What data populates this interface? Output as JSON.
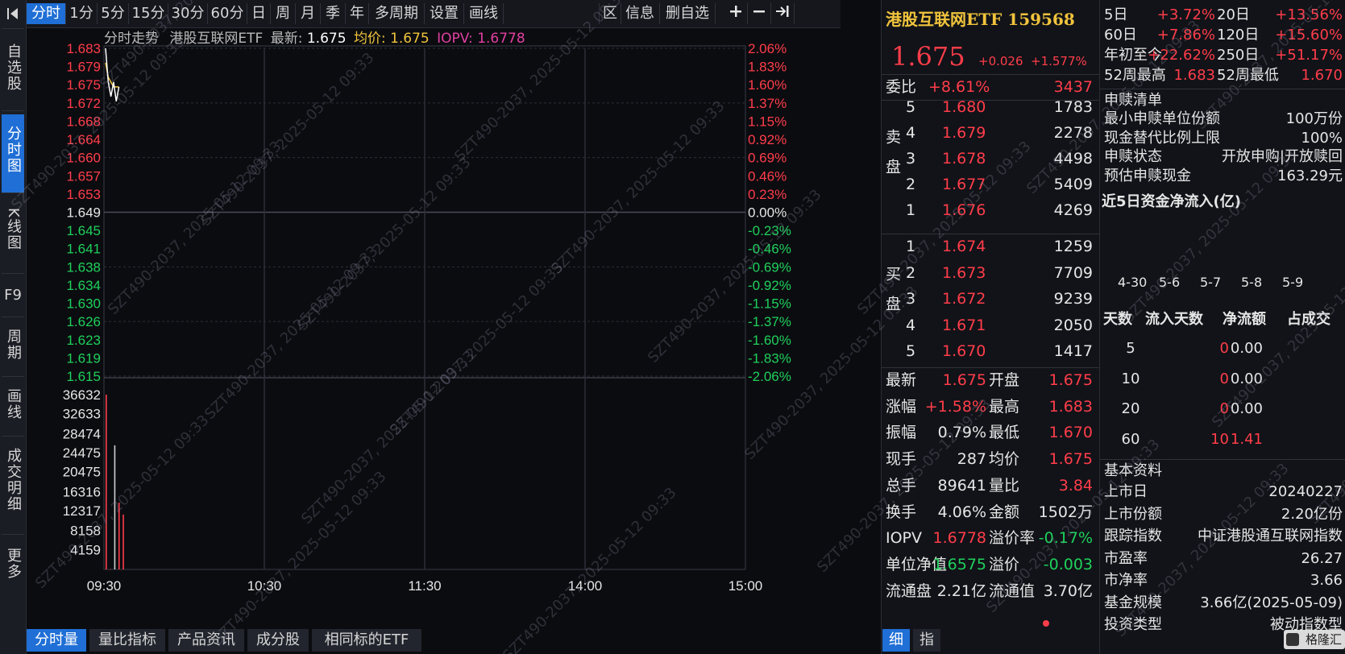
{
  "sidebar": {
    "items": [
      {
        "label": "自选股"
      },
      {
        "label": "分时图"
      },
      {
        "label": "K线图"
      },
      {
        "label": "F9"
      },
      {
        "label": "周期"
      },
      {
        "label": "画线"
      },
      {
        "label": "成交明细"
      },
      {
        "label": "更多"
      }
    ],
    "active_index": 1
  },
  "toolbar": {
    "items": [
      "分时",
      "1分",
      "5分",
      "15分",
      "30分",
      "60分",
      "日",
      "周",
      "月",
      "季",
      "年",
      "多周期",
      "设置",
      "画线"
    ],
    "right_items": [
      "区",
      "信息",
      "删自选"
    ]
  },
  "chart_header": {
    "title": "分时走势",
    "name": "港股互联网ETF",
    "latest_label": "最新:",
    "latest_value": "1.675",
    "avg_label": "均价:",
    "avg_value": "1.675",
    "iopv_label": "IOPV:",
    "iopv_value": "1.6778"
  },
  "chart_data": {
    "type": "line",
    "price_ticks": [
      "1.683",
      "1.679",
      "1.675",
      "1.672",
      "1.668",
      "1.664",
      "1.660",
      "1.657",
      "1.653",
      "1.649",
      "1.645",
      "1.641",
      "1.638",
      "1.634",
      "1.630",
      "1.626",
      "1.623",
      "1.619",
      "1.615"
    ],
    "pct_ticks": [
      "2.06%",
      "1.83%",
      "1.60%",
      "1.37%",
      "1.15%",
      "0.92%",
      "0.69%",
      "0.46%",
      "0.23%",
      "0.00%",
      "-0.23%",
      "-0.46%",
      "-0.69%",
      "-0.92%",
      "-1.15%",
      "-1.37%",
      "-1.60%",
      "-1.83%",
      "-2.06%"
    ],
    "base_price": 1.649,
    "ylim": [
      1.615,
      1.683
    ],
    "volume_ticks": [
      "36632",
      "32633",
      "28474",
      "24475",
      "20475",
      "16316",
      "12317",
      "8158",
      "4159"
    ],
    "volume_max": 40000,
    "time_labels": [
      "09:30",
      "10:30",
      "11:30",
      "14:00",
      "15:00"
    ],
    "price_series": [
      {
        "t": 0,
        "p": 1.683
      },
      {
        "t": 1,
        "p": 1.676
      },
      {
        "t": 2,
        "p": 1.673
      },
      {
        "t": 3,
        "p": 1.676
      },
      {
        "t": 4,
        "p": 1.672
      },
      {
        "t": 5,
        "p": 1.675
      }
    ],
    "avg_series": [
      {
        "t": 0,
        "p": 1.68
      },
      {
        "t": 1,
        "p": 1.677
      },
      {
        "t": 2,
        "p": 1.676
      },
      {
        "t": 3,
        "p": 1.675
      },
      {
        "t": 4,
        "p": 1.675
      },
      {
        "t": 5,
        "p": 1.675
      }
    ],
    "volume_series": [
      {
        "t": 0,
        "v": 36632,
        "dir": "up"
      },
      {
        "t": 1,
        "v": 30,
        "dir": "up"
      },
      {
        "t": 2,
        "v": 26000,
        "dir": "down"
      },
      {
        "t": 3,
        "v": 14000,
        "dir": "up"
      },
      {
        "t": 4,
        "v": 11500,
        "dir": "up"
      }
    ],
    "total_minutes": 240
  },
  "bottom_tabs": [
    "分时量",
    "量比指标",
    "产品资讯",
    "成分股",
    "相同标的ETF"
  ],
  "quote": {
    "title": "港股互联网ETF 159568",
    "price": "1.675",
    "change": "+0.026",
    "change_pct": "+1.577%",
    "weibi_label": "委比",
    "weibi_value": "+8.61%",
    "weibi_diff": "3437",
    "sell_label": "卖盘",
    "buy_label": "买盘",
    "asks": [
      {
        "level": "5",
        "price": "1.680",
        "vol": "1783"
      },
      {
        "level": "4",
        "price": "1.679",
        "vol": "2278"
      },
      {
        "level": "3",
        "price": "1.678",
        "vol": "4498"
      },
      {
        "level": "2",
        "price": "1.677",
        "vol": "5409"
      },
      {
        "level": "1",
        "price": "1.676",
        "vol": "4269"
      }
    ],
    "bids": [
      {
        "level": "1",
        "price": "1.674",
        "vol": "1259"
      },
      {
        "level": "2",
        "price": "1.673",
        "vol": "7709"
      },
      {
        "level": "3",
        "price": "1.672",
        "vol": "9239"
      },
      {
        "level": "4",
        "price": "1.671",
        "vol": "2050"
      },
      {
        "level": "5",
        "price": "1.670",
        "vol": "1417"
      }
    ],
    "stats": [
      {
        "l1": "最新",
        "v1": "1.675",
        "c1": "red",
        "l2": "开盘",
        "v2": "1.675",
        "c2": "red"
      },
      {
        "l1": "涨幅",
        "v1": "+1.58%",
        "c1": "red",
        "l2": "最高",
        "v2": "1.683",
        "c2": "red"
      },
      {
        "l1": "振幅",
        "v1": "0.79%",
        "c1": "white",
        "l2": "最低",
        "v2": "1.670",
        "c2": "red"
      },
      {
        "l1": "现手",
        "v1": "287",
        "c1": "white",
        "l2": "均价",
        "v2": "1.675",
        "c2": "red"
      },
      {
        "l1": "总手",
        "v1": "89641",
        "c1": "white",
        "l2": "量比",
        "v2": "3.84",
        "c2": "red"
      },
      {
        "l1": "换手",
        "v1": "4.06%",
        "c1": "white",
        "l2": "金额",
        "v2": "1502万",
        "c2": "white"
      },
      {
        "l1": "IOPV",
        "v1": "1.6778",
        "c1": "red",
        "l2": "溢价率",
        "v2": "-0.17%",
        "c2": "green"
      },
      {
        "l1": "单位净值",
        "v1": "1.6575",
        "c1": "green",
        "l2": "溢价",
        "v2": "-0.003",
        "c2": "green"
      },
      {
        "l1": "流通盘",
        "v1": "2.21亿",
        "c1": "white",
        "l2": "流通值",
        "v2": "3.70亿",
        "c2": "white"
      }
    ],
    "bottom_tabs": [
      "细",
      "指"
    ]
  },
  "info": {
    "returns": [
      {
        "l1": "5日",
        "v1": "+3.72%",
        "l2": "20日",
        "v2": "+13.56%"
      },
      {
        "l1": "60日",
        "v1": "+7.86%",
        "l2": "120日",
        "v2": "+15.60%"
      },
      {
        "l1": "年初至今",
        "v1": "+22.62%",
        "l2": "250日",
        "v2": "+51.17%"
      },
      {
        "l1": "52周最高",
        "v1": "1.683",
        "l2": "52周最低",
        "v2": "1.670"
      }
    ],
    "redeem_title": "申赎清单",
    "redeem": [
      {
        "k": "最小申赎单位份额",
        "v": "100万份"
      },
      {
        "k": "现金替代比例上限",
        "v": "100%"
      },
      {
        "k": "申赎状态",
        "v": "开放申购|开放赎回"
      },
      {
        "k": "预估申赎现金",
        "v": "163.29元"
      }
    ],
    "flow_title": "近5日资金净流入(亿)",
    "flow_dates": [
      "4-30",
      "5-6",
      "5-7",
      "5-8",
      "5-9"
    ],
    "flow_headers": [
      "天数",
      "流入天数",
      "净流额",
      "占成交"
    ],
    "flow_rows": [
      {
        "d": "5",
        "n": "0",
        "v": "0.00",
        "nc": "red",
        "vc": "white"
      },
      {
        "d": "10",
        "n": "0",
        "v": "0.00",
        "nc": "red",
        "vc": "white"
      },
      {
        "d": "20",
        "n": "0",
        "v": "0.00",
        "nc": "red",
        "vc": "white"
      },
      {
        "d": "60",
        "n": "10",
        "v": "1.41",
        "nc": "red",
        "vc": "red"
      }
    ],
    "basic_title": "基本资料",
    "basic": [
      {
        "k": "上市日",
        "v": "20240227"
      },
      {
        "k": "上市份额",
        "v": "2.20亿份"
      },
      {
        "k": "跟踪指数",
        "v": "中证港股通互联网指数"
      },
      {
        "k": "市盈率",
        "v": "26.27"
      },
      {
        "k": "市净率",
        "v": "3.66"
      },
      {
        "k": "基金规模",
        "v": "3.66亿(2025-05-09)"
      },
      {
        "k": "投资类型",
        "v": "被动指数型"
      }
    ],
    "logo_text": "格隆汇"
  },
  "watermark": "SZT490-2037, 2025-05-12 09:33",
  "colors": {
    "accent": "#1f6fd6",
    "up": "#ff3d4a",
    "down": "#1fd05b",
    "title": "#f0c33c",
    "price_line": "#ffffff",
    "avg_line": "#f0c33c"
  }
}
